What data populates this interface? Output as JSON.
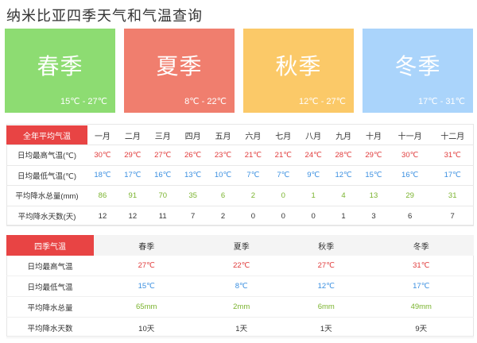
{
  "title": "纳米比亚四季天气和气温查询",
  "seasons": [
    {
      "name": "春季",
      "range": "15℃ - 27℃",
      "color": "#8ddc72"
    },
    {
      "name": "夏季",
      "range": "8℃ - 22℃",
      "color": "#f07e6e"
    },
    {
      "name": "秋季",
      "range": "12℃ - 27℃",
      "color": "#fbc968"
    },
    {
      "name": "冬季",
      "range": "17℃ - 31℃",
      "color": "#aad4fb"
    }
  ],
  "annual": {
    "header": "全年平均气温",
    "months": [
      "一月",
      "二月",
      "三月",
      "四月",
      "五月",
      "六月",
      "七月",
      "八月",
      "九月",
      "十月",
      "十一月",
      "十二月"
    ],
    "rows": [
      {
        "label": "日均最高气温(℃)",
        "values": [
          "30℃",
          "29℃",
          "27℃",
          "26℃",
          "23℃",
          "21℃",
          "21℃",
          "24℃",
          "28℃",
          "29℃",
          "30℃",
          "31℃"
        ]
      },
      {
        "label": "日均最低气温(℃)",
        "values": [
          "18℃",
          "17℃",
          "16℃",
          "13℃",
          "10℃",
          "7℃",
          "7℃",
          "9℃",
          "12℃",
          "15℃",
          "16℃",
          "17℃"
        ]
      },
      {
        "label": "平均降水总量(mm)",
        "values": [
          "86",
          "91",
          "70",
          "35",
          "6",
          "2",
          "0",
          "1",
          "4",
          "13",
          "29",
          "31"
        ]
      },
      {
        "label": "平均降水天数(天)",
        "values": [
          "12",
          "12",
          "11",
          "7",
          "2",
          "0",
          "0",
          "0",
          "1",
          "3",
          "6",
          "7"
        ]
      }
    ]
  },
  "seasonal": {
    "header": "四季气温",
    "seasons": [
      "春季",
      "夏季",
      "秋季",
      "冬季"
    ],
    "rows": [
      {
        "label": "日均最高气温",
        "values": [
          "27℃",
          "22℃",
          "27℃",
          "31℃"
        ]
      },
      {
        "label": "日均最低气温",
        "values": [
          "15℃",
          "8℃",
          "12℃",
          "17℃"
        ]
      },
      {
        "label": "平均降水总量",
        "values": [
          "65mm",
          "2mm",
          "6mm",
          "49mm"
        ]
      },
      {
        "label": "平均降水天数",
        "values": [
          "10天",
          "1天",
          "1天",
          "9天"
        ]
      }
    ]
  }
}
